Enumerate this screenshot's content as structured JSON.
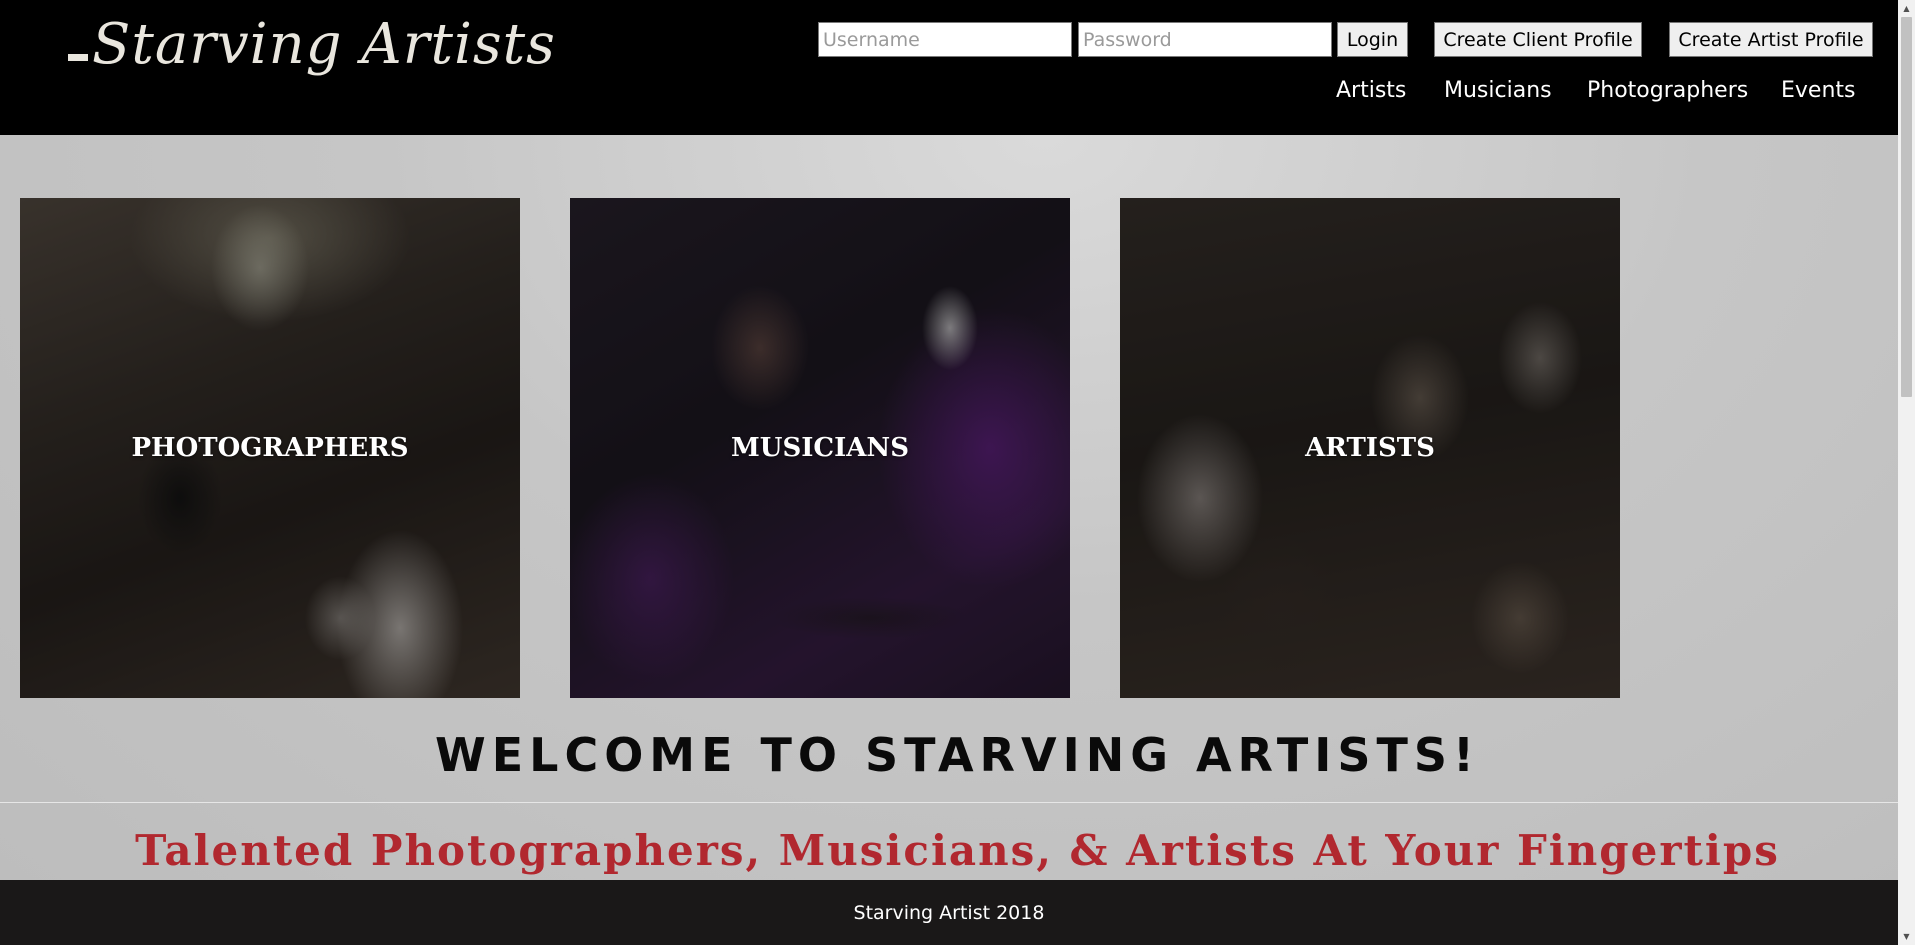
{
  "header": {
    "logo_text": "Starving Artists",
    "username_placeholder": "Username",
    "password_placeholder": "Password",
    "login_label": "Login",
    "create_client_label": "Create Client Profile",
    "create_artist_label": "Create Artist Profile",
    "nav": {
      "artists": "Artists",
      "musicians": "Musicians",
      "photographers": "Photographers",
      "events": "Events"
    }
  },
  "tiles": [
    {
      "label": "PHOTOGRAPHERS"
    },
    {
      "label": "MUSICIANS"
    },
    {
      "label": "ARTISTS"
    }
  ],
  "welcome_text": "WELCOME TO STARVING ARTISTS!",
  "tagline_text": "Talented Photographers, Musicians, & Artists At Your Fingertips",
  "footer_text": "Starving Artist 2018",
  "colors": {
    "header_bg": "#000000",
    "tagline": "#b1282f",
    "footer_bg": "#1a1818"
  }
}
